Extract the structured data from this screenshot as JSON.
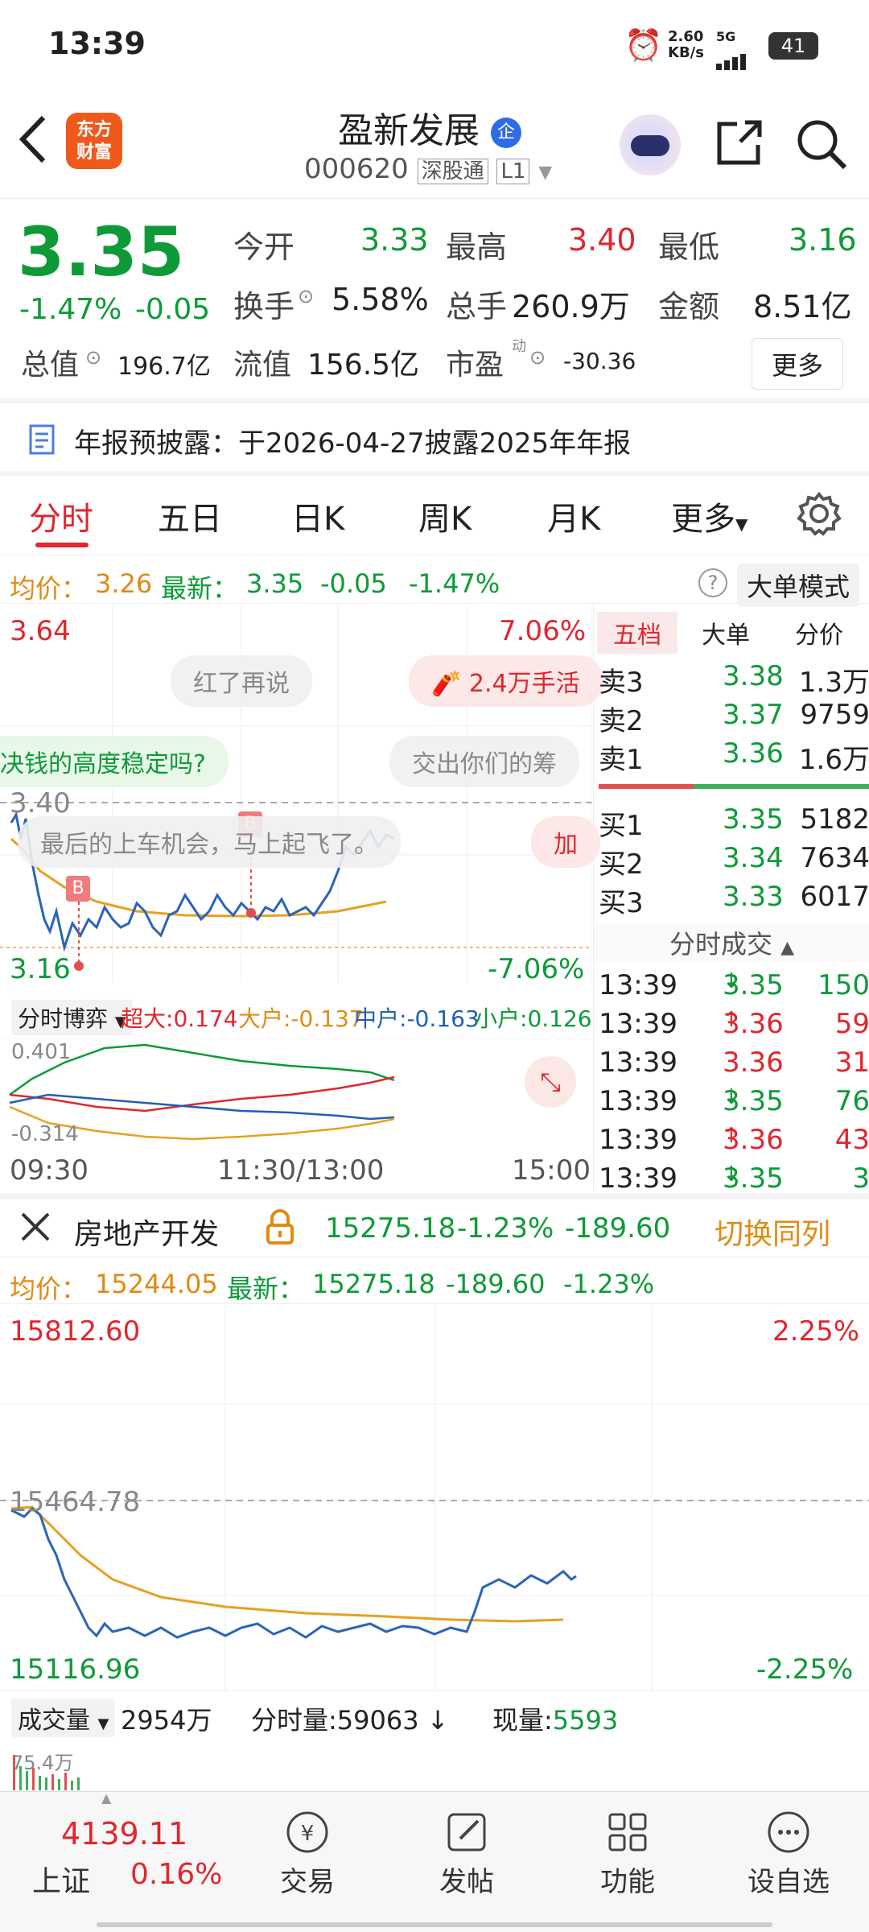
{
  "status": {
    "time": "13:39",
    "speed_top": "2.60",
    "speed_bottom": "KB/s",
    "net": "5G",
    "battery": "41"
  },
  "header": {
    "name": "盈新发展",
    "badge": "企",
    "code": "000620",
    "tag1": "深股通",
    "tag2": "L1",
    "logo_line1": "东方",
    "logo_line2": "财富"
  },
  "quote": {
    "price": "3.35",
    "pct": "-1.47%",
    "chg": "-0.05",
    "r1": [
      {
        "label": "今开",
        "value": "3.33"
      },
      {
        "label": "最高",
        "value": "3.40"
      },
      {
        "label": "最低",
        "value": "3.16"
      }
    ],
    "r2": [
      {
        "label": "换手",
        "value": "5.58%"
      },
      {
        "label": "总手",
        "value": "260.9万"
      },
      {
        "label": "金额",
        "value": "8.51亿"
      }
    ],
    "r3": [
      {
        "label": "总值",
        "value": "196.7亿"
      },
      {
        "label": "流值",
        "value": "156.5亿"
      },
      {
        "label": "市盈",
        "sup": "动",
        "value": "-30.36"
      }
    ],
    "more": "更多"
  },
  "notice": "年报预披露：于2026-04-27披露2025年年报",
  "tabs": [
    "分时",
    "五日",
    "日K",
    "周K",
    "月K",
    "更多"
  ],
  "avgline": {
    "avg_label": "均价：",
    "avg": "3.26",
    "latest_label": "最新：",
    "latest": "3.35",
    "chg": "-0.05",
    "pct": "-1.47%",
    "mode": "大单模式"
  },
  "chart": {
    "high": "3.64",
    "high_pct": "7.06%",
    "low": "3.16",
    "low_pct": "-7.06%",
    "prev": "3.40",
    "times": [
      "09:30",
      "11:30/13:00",
      "15:00"
    ],
    "bubbles": [
      "红了再说",
      "2.4万手活",
      "决钱的高度稳定吗?",
      "交出你们的筹",
      "最后的上车机会，马上起飞了。",
      "加"
    ],
    "flow_label": "分时博弈",
    "flows": [
      {
        "name": "超大:",
        "value": "0.174"
      },
      {
        "name": "大户:",
        "value": "-0.137"
      },
      {
        "name": "中户:",
        "value": "-0.163"
      },
      {
        "name": "小户:",
        "value": "0.126"
      }
    ],
    "flow_top": "0.401",
    "flow_bottom": "-0.314"
  },
  "book": {
    "tabs": [
      "五档",
      "大单",
      "分价"
    ],
    "asks": [
      {
        "label": "卖3",
        "price": "3.38",
        "vol": "1.3万"
      },
      {
        "label": "卖2",
        "price": "3.37",
        "vol": "9759"
      },
      {
        "label": "卖1",
        "price": "3.36",
        "vol": "1.6万"
      }
    ],
    "bids": [
      {
        "label": "买1",
        "price": "3.35",
        "vol": "5182"
      },
      {
        "label": "买2",
        "price": "3.34",
        "vol": "7634"
      },
      {
        "label": "买3",
        "price": "3.33",
        "vol": "6017"
      }
    ],
    "ticks_title": "分时成交",
    "ticks": [
      {
        "t": "13:39",
        "p": "3.35",
        "d": "↓",
        "v": "150",
        "c": "green"
      },
      {
        "t": "13:39",
        "p": "3.36",
        "d": "↑",
        "v": "59",
        "c": "red"
      },
      {
        "t": "13:39",
        "p": "3.36",
        "d": "",
        "v": "31",
        "c": "red"
      },
      {
        "t": "13:39",
        "p": "3.35",
        "d": "↓",
        "v": "76",
        "c": "green"
      },
      {
        "t": "13:39",
        "p": "3.36",
        "d": "↑",
        "v": "43",
        "c": "red"
      },
      {
        "t": "13:39",
        "p": "3.35",
        "d": "↓",
        "v": "3",
        "c": "green"
      }
    ]
  },
  "sector": {
    "name": "房地产开发",
    "value": "15275.18",
    "pct": "-1.23%",
    "chg": "-189.60",
    "switch": "切换同列",
    "avg_label": "均价：",
    "avg": "15244.05",
    "latest_label": "最新：",
    "latest": "15275.18",
    "chg2": "-189.60",
    "pct2": "-1.23%",
    "high": "15812.60",
    "high_pct": "2.25%",
    "prev": "15464.78",
    "low": "15116.96",
    "low_pct": "-2.25%",
    "vol_label": "成交量",
    "vol": "2954万",
    "fs_label": "分时量:",
    "fs": "59063",
    "now_label": "现量:",
    "now": "5593",
    "vmax": "75.4万"
  },
  "bottom": {
    "index_value": "4139.11",
    "index_name": "上证",
    "index_pct": "0.16%",
    "items": [
      "交易",
      "发帖",
      "功能",
      "设自选"
    ]
  }
}
